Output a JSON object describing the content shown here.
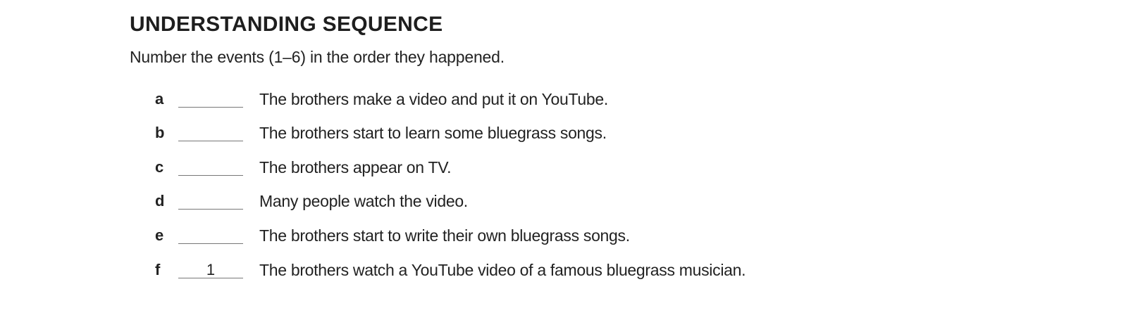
{
  "title": "UNDERSTANDING SEQUENCE",
  "instructions": "Number the events (1–6) in the order they happened.",
  "items": [
    {
      "letter": "a",
      "answer": "",
      "text": "The brothers make a video and put it on YouTube."
    },
    {
      "letter": "b",
      "answer": "",
      "text": "The brothers start to learn some bluegrass songs."
    },
    {
      "letter": "c",
      "answer": "",
      "text": "The brothers appear on TV."
    },
    {
      "letter": "d",
      "answer": "",
      "text": "Many people watch the video."
    },
    {
      "letter": "e",
      "answer": "",
      "text": "The brothers start to write their own bluegrass songs."
    },
    {
      "letter": "f",
      "answer": "1",
      "text": "The brothers watch a YouTube video of a famous bluegrass musician."
    }
  ]
}
